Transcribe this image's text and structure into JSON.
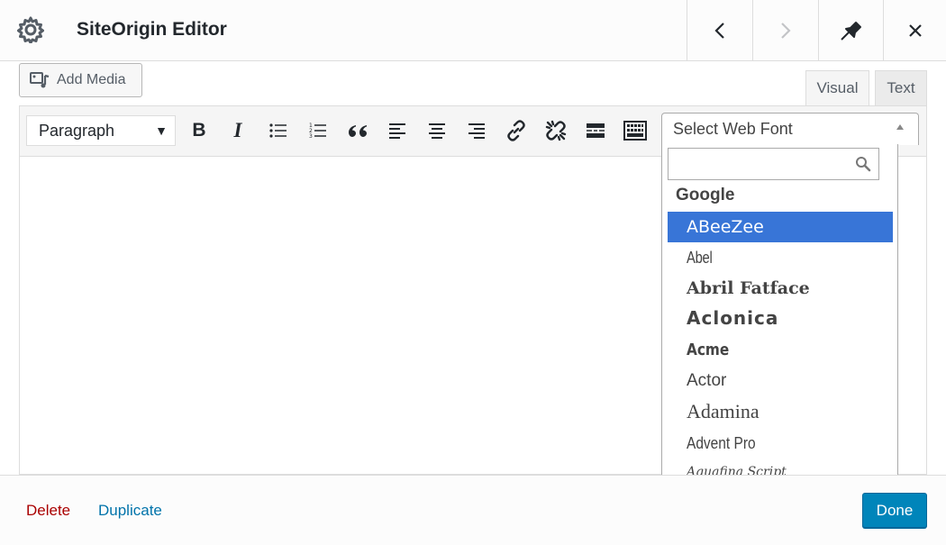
{
  "header": {
    "title": "SiteOrigin Editor",
    "icons": [
      "gear-icon",
      "chevron-left-icon",
      "chevron-right-icon",
      "pin-icon",
      "close-icon"
    ]
  },
  "media": {
    "add_media_label": "Add Media"
  },
  "tabs": {
    "visual": "Visual",
    "text": "Text",
    "active": "Visual"
  },
  "toolbar": {
    "format_value": "Paragraph",
    "buttons": [
      "bold",
      "italic",
      "bulleted-list",
      "numbered-list",
      "blockquote",
      "align-left",
      "align-center",
      "align-right",
      "insert-link",
      "remove-link",
      "read-more",
      "toolbar-toggle"
    ],
    "bold_label": "B",
    "italic_label": "I"
  },
  "webfont": {
    "placeholder": "Select Web Font",
    "search_value": "",
    "group": "Google",
    "options": [
      "ABeeZee",
      "Abel",
      "Abril Fatface",
      "Aclonica",
      "Acme",
      "Actor",
      "Adamina",
      "Advent Pro",
      "Aguafina Script"
    ],
    "highlighted": "ABeeZee"
  },
  "footer": {
    "delete_label": "Delete",
    "duplicate_label": "Duplicate",
    "done_label": "Done"
  },
  "colors": {
    "primary_button": "#0085ba",
    "delete_link": "#aa0000",
    "duplicate_link": "#0073aa",
    "highlight": "#3875d7"
  }
}
